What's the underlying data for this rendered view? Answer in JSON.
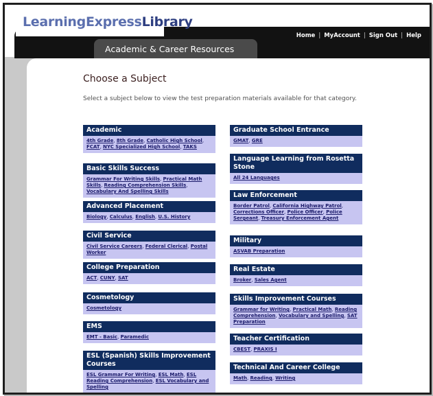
{
  "app": {
    "logo_part1": "LearningExpress",
    "logo_part2": "Library",
    "section_tab": "Academic & Career Resources"
  },
  "toplinks": [
    "Home",
    "MyAccount",
    "Sign Out",
    "Help"
  ],
  "page": {
    "title": "Choose a Subject",
    "intro": "Select a subject below to view the test preparation materials available for that category."
  },
  "left_column": [
    {
      "title": "Academic",
      "links": [
        "4th Grade",
        "8th Grade",
        "Catholic High School",
        "FCAT",
        "NYC Specialized High School",
        "TAKS"
      ]
    },
    {
      "title": "Basic Skills Success",
      "links": [
        "Grammar For Writing Skills",
        "Practical Math Skills",
        "Reading Comprehension Skills",
        "Vocabulary And Spelling Skills"
      ]
    },
    {
      "title": "Advanced Placement",
      "links": [
        "Biology",
        "Calculus",
        "English",
        "U.S. History"
      ]
    },
    {
      "title": "Civil Service",
      "links": [
        "Civil Service Careers",
        "Federal Clerical",
        "Postal Worker"
      ]
    },
    {
      "title": "College Preparation",
      "links": [
        "ACT",
        "CUNY",
        "SAT"
      ]
    },
    {
      "title": "Cosmetology",
      "links": [
        "Cosmetology"
      ]
    },
    {
      "title": "EMS",
      "links": [
        "EMT - Basic",
        "Paramedic"
      ]
    },
    {
      "title": "ESL (Spanish) Skills Improvement Courses",
      "links": [
        "ESL Grammar For Writing",
        "ESL Math",
        "ESL Reading Comprehension",
        "ESL Vocabulary and Spelling"
      ]
    }
  ],
  "right_column": [
    {
      "title": "Graduate School Entrance",
      "links": [
        "GMAT",
        "GRE"
      ]
    },
    {
      "title": "Language Learning from Rosetta Stone",
      "links": [
        "All 24 Languages"
      ]
    },
    {
      "title": "Law Enforcement",
      "links": [
        "Border Patrol",
        "California Highway Patrol",
        "Corrections Officer",
        "Police Officer",
        "Police Sergeant",
        "Treasury Enforcement Agent"
      ]
    },
    {
      "title": "Military",
      "links": [
        "ASVAB Preparation"
      ]
    },
    {
      "title": "Real Estate",
      "links": [
        "Broker",
        "Sales Agent"
      ]
    },
    {
      "title": "Skills Improvement Courses",
      "links": [
        "Grammar for Writing",
        "Practical Math",
        "Reading Comprehension",
        "Vocabulary and Spelling",
        "SAT Preparation"
      ]
    },
    {
      "title": "Teacher Certification",
      "links": [
        "CBEST",
        "PRAXIS I"
      ]
    },
    {
      "title": "Technical And Career College",
      "links": [
        "Math",
        "Reading",
        "Writing"
      ]
    }
  ],
  "colors": {
    "header_blue": "#102c5e",
    "box_lavender": "#c7c5f1",
    "link": "#1a1a6a"
  }
}
